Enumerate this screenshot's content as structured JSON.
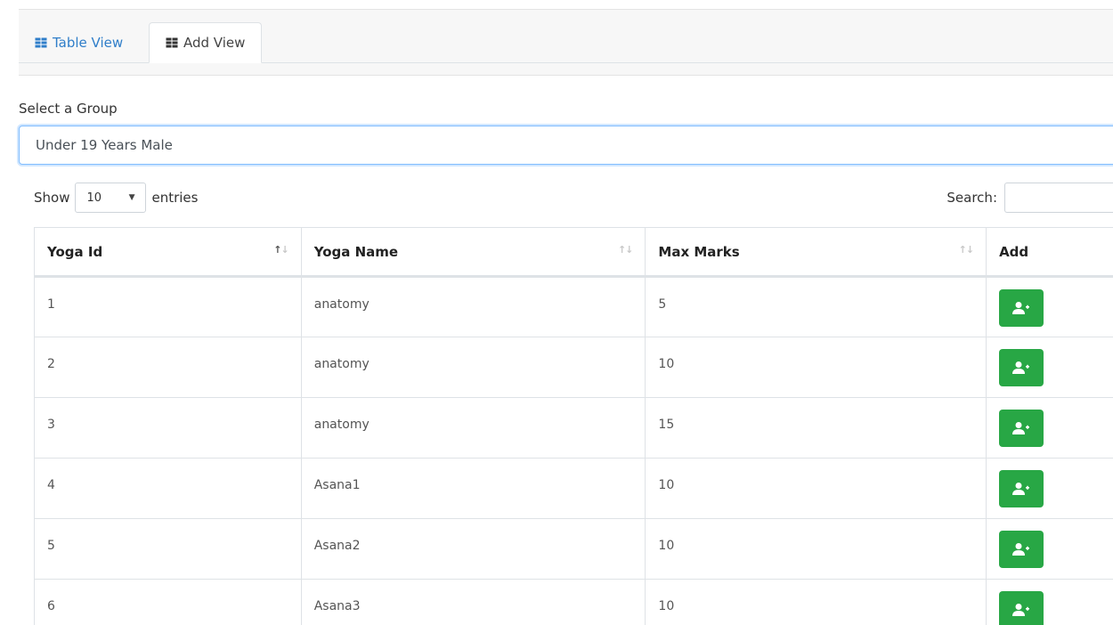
{
  "tabs": [
    {
      "label": "Table View",
      "active": false
    },
    {
      "label": "Add View",
      "active": true
    }
  ],
  "group": {
    "label": "Select a Group",
    "selected": "Under 19 Years Male"
  },
  "length": {
    "show_label": "Show",
    "value": "10",
    "entries_label": "entries"
  },
  "search": {
    "label": "Search:",
    "value": ""
  },
  "table": {
    "headers": [
      "Yoga Id",
      "Yoga Name",
      "Max Marks",
      "Add"
    ],
    "rows": [
      {
        "id": "1",
        "name": "anatomy",
        "marks": "5"
      },
      {
        "id": "2",
        "name": "anatomy",
        "marks": "10"
      },
      {
        "id": "3",
        "name": "anatomy",
        "marks": "15"
      },
      {
        "id": "4",
        "name": "Asana1",
        "marks": "10"
      },
      {
        "id": "5",
        "name": "Asana2",
        "marks": "10"
      },
      {
        "id": "6",
        "name": "Asana3",
        "marks": "10"
      }
    ]
  },
  "icons": {
    "tab_icon": "table-icon",
    "add_icon": "user-plus-icon",
    "sort_icon": "sort-arrows-icon"
  },
  "colors": {
    "accent": "#2f7ec9",
    "add_button": "#28a745",
    "focus_border": "#80bdff"
  }
}
